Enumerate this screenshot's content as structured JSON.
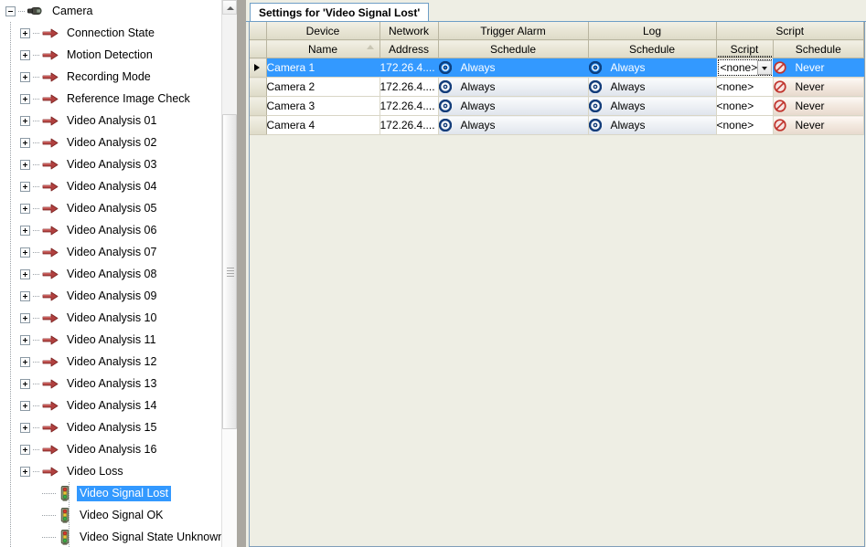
{
  "window": {
    "accent_selection": "#3399ff",
    "panel_background": "#eeeee4",
    "tab_border": "#6e9ec6"
  },
  "tree": {
    "root": {
      "label": "Camera",
      "icon": "camera-icon",
      "expander": "minus"
    },
    "branches": [
      {
        "label": "Connection State",
        "icon": "red-arrow-icon",
        "expander": "plus"
      },
      {
        "label": "Motion Detection",
        "icon": "red-arrow-icon",
        "expander": "plus"
      },
      {
        "label": "Recording Mode",
        "icon": "red-arrow-icon",
        "expander": "plus"
      },
      {
        "label": "Reference Image Check",
        "icon": "red-arrow-icon",
        "expander": "plus"
      },
      {
        "label": "Video Analysis 01",
        "icon": "red-arrow-icon",
        "expander": "plus"
      },
      {
        "label": "Video Analysis 02",
        "icon": "red-arrow-icon",
        "expander": "plus"
      },
      {
        "label": "Video Analysis 03",
        "icon": "red-arrow-icon",
        "expander": "plus"
      },
      {
        "label": "Video Analysis 04",
        "icon": "red-arrow-icon",
        "expander": "plus"
      },
      {
        "label": "Video Analysis 05",
        "icon": "red-arrow-icon",
        "expander": "plus"
      },
      {
        "label": "Video Analysis 06",
        "icon": "red-arrow-icon",
        "expander": "plus"
      },
      {
        "label": "Video Analysis 07",
        "icon": "red-arrow-icon",
        "expander": "plus"
      },
      {
        "label": "Video Analysis 08",
        "icon": "red-arrow-icon",
        "expander": "plus"
      },
      {
        "label": "Video Analysis 09",
        "icon": "red-arrow-icon",
        "expander": "plus"
      },
      {
        "label": "Video Analysis 10",
        "icon": "red-arrow-icon",
        "expander": "plus"
      },
      {
        "label": "Video Analysis 11",
        "icon": "red-arrow-icon",
        "expander": "plus"
      },
      {
        "label": "Video Analysis 12",
        "icon": "red-arrow-icon",
        "expander": "plus"
      },
      {
        "label": "Video Analysis 13",
        "icon": "red-arrow-icon",
        "expander": "plus"
      },
      {
        "label": "Video Analysis 14",
        "icon": "red-arrow-icon",
        "expander": "plus"
      },
      {
        "label": "Video Analysis 15",
        "icon": "red-arrow-icon",
        "expander": "plus"
      },
      {
        "label": "Video Analysis 16",
        "icon": "red-arrow-icon",
        "expander": "plus"
      },
      {
        "label": "Video Loss",
        "icon": "red-arrow-icon",
        "expander": "minus"
      }
    ],
    "leaves": [
      {
        "label": "Video Signal Lost",
        "icon": "traffic-light-icon",
        "selected": true
      },
      {
        "label": "Video Signal OK",
        "icon": "traffic-light-icon",
        "selected": false
      },
      {
        "label": "Video Signal State Unknown",
        "icon": "traffic-light-icon",
        "selected": false
      }
    ]
  },
  "tab": {
    "label": "Settings for 'Video Signal Lost'"
  },
  "grid": {
    "group_headers": [
      {
        "label": "Device",
        "span": 1
      },
      {
        "label": "Network",
        "span": 1
      },
      {
        "label": "Trigger Alarm",
        "span": 1
      },
      {
        "label": "Log",
        "span": 1
      },
      {
        "label": "Script",
        "span": 2
      }
    ],
    "sub_headers": [
      {
        "label": "Name",
        "sorted": "ascending"
      },
      {
        "label": "Address",
        "sorted": ""
      },
      {
        "label": "Schedule",
        "sorted": ""
      },
      {
        "label": "Schedule",
        "sorted": ""
      },
      {
        "label": "Script",
        "sorted": "",
        "focused": true
      },
      {
        "label": "Schedule",
        "sorted": ""
      }
    ],
    "rows": [
      {
        "selected": true,
        "name": "Camera 1",
        "address": "172.26.4....",
        "trigger_schedule": "Always",
        "trigger_icon": "ring-icon",
        "log_schedule": "Always",
        "log_icon": "ring-icon",
        "script": "<none>",
        "script_editing": true,
        "script_schedule": "Never",
        "script_schedule_icon": "forbidden-icon"
      },
      {
        "selected": false,
        "name": "Camera 2",
        "address": "172.26.4....",
        "trigger_schedule": "Always",
        "trigger_icon": "ring-icon",
        "log_schedule": "Always",
        "log_icon": "ring-icon",
        "script": "<none>",
        "script_editing": false,
        "script_schedule": "Never",
        "script_schedule_icon": "forbidden-icon"
      },
      {
        "selected": false,
        "name": "Camera 3",
        "address": "172.26.4....",
        "trigger_schedule": "Always",
        "trigger_icon": "ring-icon",
        "log_schedule": "Always",
        "log_icon": "ring-icon",
        "script": "<none>",
        "script_editing": false,
        "script_schedule": "Never",
        "script_schedule_icon": "forbidden-icon"
      },
      {
        "selected": false,
        "name": "Camera 4",
        "address": "172.26.4....",
        "trigger_schedule": "Always",
        "trigger_icon": "ring-icon",
        "log_schedule": "Always",
        "log_icon": "ring-icon",
        "script": "<none>",
        "script_editing": false,
        "script_schedule": "Never",
        "script_schedule_icon": "forbidden-icon"
      }
    ]
  },
  "scrollbar": {
    "up_arrow": "scroll-up-arrow-icon",
    "position_label": ""
  }
}
